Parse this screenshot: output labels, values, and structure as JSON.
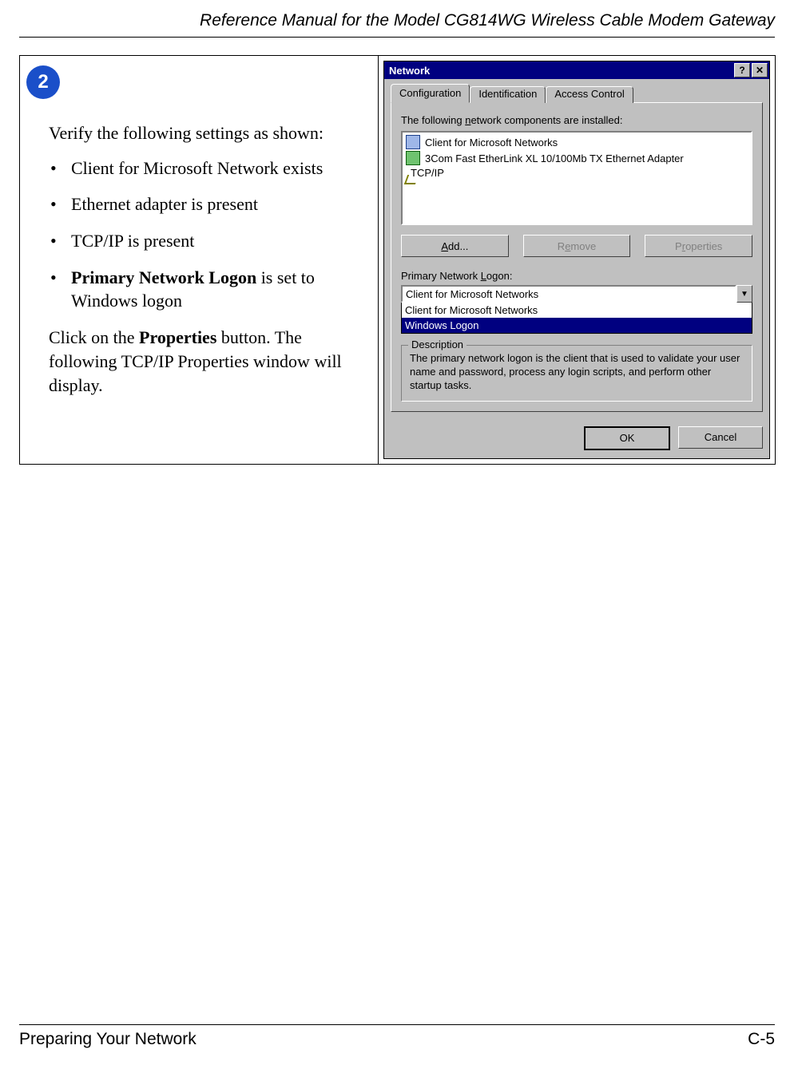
{
  "header": {
    "title": "Reference Manual for the Model CG814WG Wireless Cable Modem Gateway"
  },
  "step": {
    "number": "2"
  },
  "instructions": {
    "intro": "Verify the following settings as shown:",
    "bullets": [
      "Client for Microsoft Network exists",
      "Ethernet adapter is present",
      "TCP/IP is present"
    ],
    "bullet4_prefix_bold": "Primary Network Logon",
    "bullet4_suffix": " is set to Windows logon",
    "after1_a": "Click on the ",
    "after1_bold": "Properties",
    "after1_b": " button. The following TCP/IP Properties window will display."
  },
  "dialog": {
    "title": "Network",
    "help_btn": "?",
    "close_btn": "✕",
    "tabs": {
      "configuration": "Configuration",
      "identification": "Identification",
      "access_control": "Access Control"
    },
    "components_label_pre": "The following ",
    "components_label_accel": "n",
    "components_label_post": "etwork components are installed:",
    "components": [
      "Client for Microsoft Networks",
      "3Com Fast EtherLink XL 10/100Mb TX Ethernet Adapter",
      "TCP/IP"
    ],
    "buttons": {
      "add": "Add...",
      "remove": "Remove",
      "properties": "Properties"
    },
    "primary_logon_label_pre": "Primary Network ",
    "primary_logon_label_accel": "L",
    "primary_logon_label_post": "ogon:",
    "combo_selected": "Client for Microsoft Networks",
    "combo_options": [
      "Client for Microsoft Networks",
      "Windows Logon"
    ],
    "description": {
      "legend": "Description",
      "text": "The primary network logon is the client that is used to validate your user name and password, process any login scripts, and perform other startup tasks."
    },
    "footer": {
      "ok": "OK",
      "cancel": "Cancel"
    }
  },
  "page_footer": {
    "section": "Preparing Your Network",
    "page_number": "C-5"
  }
}
